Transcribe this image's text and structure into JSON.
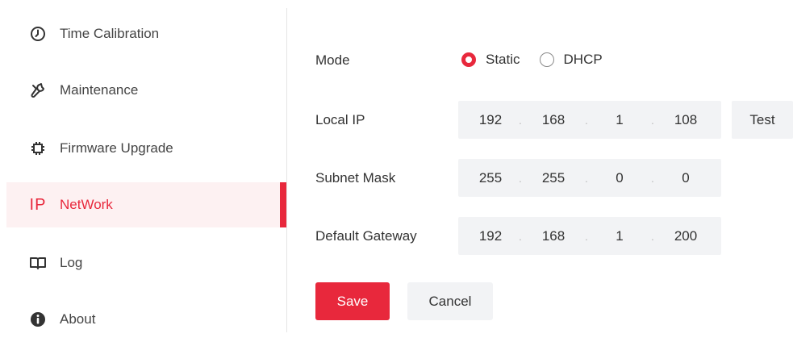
{
  "sidebar": {
    "items": [
      {
        "label": "Time Calibration",
        "icon": "clock-icon"
      },
      {
        "label": "Maintenance",
        "icon": "wrench-icon"
      },
      {
        "label": "Firmware Upgrade",
        "icon": "chip-icon"
      },
      {
        "label": "NetWork",
        "icon": "ip-icon",
        "icon_text": "IP",
        "active": true
      },
      {
        "label": "Log",
        "icon": "book-icon"
      },
      {
        "label": "About",
        "icon": "info-icon"
      }
    ]
  },
  "form": {
    "mode": {
      "label": "Mode",
      "options": [
        {
          "label": "Static",
          "checked": true
        },
        {
          "label": "DHCP",
          "checked": false
        }
      ]
    },
    "local_ip": {
      "label": "Local IP",
      "octets": [
        "192",
        "168",
        "1",
        "108"
      ],
      "test_label": "Test"
    },
    "subnet_mask": {
      "label": "Subnet Mask",
      "octets": [
        "255",
        "255",
        "0",
        "0"
      ]
    },
    "default_gateway": {
      "label": "Default Gateway",
      "octets": [
        "192",
        "168",
        "1",
        "200"
      ]
    },
    "dot": "."
  },
  "actions": {
    "save_label": "Save",
    "cancel_label": "Cancel"
  },
  "colors": {
    "accent": "#e8283c",
    "active_bg": "#fdf1f2",
    "field_bg": "#f2f3f5"
  }
}
